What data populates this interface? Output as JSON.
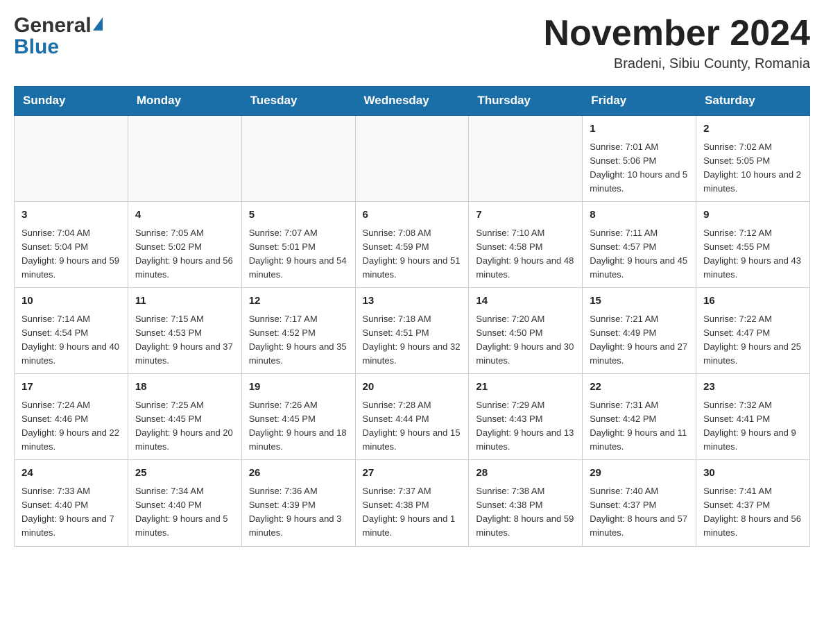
{
  "header": {
    "month_title": "November 2024",
    "location": "Bradeni, Sibiu County, Romania",
    "logo_general": "General",
    "logo_blue": "Blue"
  },
  "weekdays": [
    "Sunday",
    "Monday",
    "Tuesday",
    "Wednesday",
    "Thursday",
    "Friday",
    "Saturday"
  ],
  "weeks": [
    [
      {
        "day": "",
        "info": ""
      },
      {
        "day": "",
        "info": ""
      },
      {
        "day": "",
        "info": ""
      },
      {
        "day": "",
        "info": ""
      },
      {
        "day": "",
        "info": ""
      },
      {
        "day": "1",
        "info": "Sunrise: 7:01 AM\nSunset: 5:06 PM\nDaylight: 10 hours and 5 minutes."
      },
      {
        "day": "2",
        "info": "Sunrise: 7:02 AM\nSunset: 5:05 PM\nDaylight: 10 hours and 2 minutes."
      }
    ],
    [
      {
        "day": "3",
        "info": "Sunrise: 7:04 AM\nSunset: 5:04 PM\nDaylight: 9 hours and 59 minutes."
      },
      {
        "day": "4",
        "info": "Sunrise: 7:05 AM\nSunset: 5:02 PM\nDaylight: 9 hours and 56 minutes."
      },
      {
        "day": "5",
        "info": "Sunrise: 7:07 AM\nSunset: 5:01 PM\nDaylight: 9 hours and 54 minutes."
      },
      {
        "day": "6",
        "info": "Sunrise: 7:08 AM\nSunset: 4:59 PM\nDaylight: 9 hours and 51 minutes."
      },
      {
        "day": "7",
        "info": "Sunrise: 7:10 AM\nSunset: 4:58 PM\nDaylight: 9 hours and 48 minutes."
      },
      {
        "day": "8",
        "info": "Sunrise: 7:11 AM\nSunset: 4:57 PM\nDaylight: 9 hours and 45 minutes."
      },
      {
        "day": "9",
        "info": "Sunrise: 7:12 AM\nSunset: 4:55 PM\nDaylight: 9 hours and 43 minutes."
      }
    ],
    [
      {
        "day": "10",
        "info": "Sunrise: 7:14 AM\nSunset: 4:54 PM\nDaylight: 9 hours and 40 minutes."
      },
      {
        "day": "11",
        "info": "Sunrise: 7:15 AM\nSunset: 4:53 PM\nDaylight: 9 hours and 37 minutes."
      },
      {
        "day": "12",
        "info": "Sunrise: 7:17 AM\nSunset: 4:52 PM\nDaylight: 9 hours and 35 minutes."
      },
      {
        "day": "13",
        "info": "Sunrise: 7:18 AM\nSunset: 4:51 PM\nDaylight: 9 hours and 32 minutes."
      },
      {
        "day": "14",
        "info": "Sunrise: 7:20 AM\nSunset: 4:50 PM\nDaylight: 9 hours and 30 minutes."
      },
      {
        "day": "15",
        "info": "Sunrise: 7:21 AM\nSunset: 4:49 PM\nDaylight: 9 hours and 27 minutes."
      },
      {
        "day": "16",
        "info": "Sunrise: 7:22 AM\nSunset: 4:47 PM\nDaylight: 9 hours and 25 minutes."
      }
    ],
    [
      {
        "day": "17",
        "info": "Sunrise: 7:24 AM\nSunset: 4:46 PM\nDaylight: 9 hours and 22 minutes."
      },
      {
        "day": "18",
        "info": "Sunrise: 7:25 AM\nSunset: 4:45 PM\nDaylight: 9 hours and 20 minutes."
      },
      {
        "day": "19",
        "info": "Sunrise: 7:26 AM\nSunset: 4:45 PM\nDaylight: 9 hours and 18 minutes."
      },
      {
        "day": "20",
        "info": "Sunrise: 7:28 AM\nSunset: 4:44 PM\nDaylight: 9 hours and 15 minutes."
      },
      {
        "day": "21",
        "info": "Sunrise: 7:29 AM\nSunset: 4:43 PM\nDaylight: 9 hours and 13 minutes."
      },
      {
        "day": "22",
        "info": "Sunrise: 7:31 AM\nSunset: 4:42 PM\nDaylight: 9 hours and 11 minutes."
      },
      {
        "day": "23",
        "info": "Sunrise: 7:32 AM\nSunset: 4:41 PM\nDaylight: 9 hours and 9 minutes."
      }
    ],
    [
      {
        "day": "24",
        "info": "Sunrise: 7:33 AM\nSunset: 4:40 PM\nDaylight: 9 hours and 7 minutes."
      },
      {
        "day": "25",
        "info": "Sunrise: 7:34 AM\nSunset: 4:40 PM\nDaylight: 9 hours and 5 minutes."
      },
      {
        "day": "26",
        "info": "Sunrise: 7:36 AM\nSunset: 4:39 PM\nDaylight: 9 hours and 3 minutes."
      },
      {
        "day": "27",
        "info": "Sunrise: 7:37 AM\nSunset: 4:38 PM\nDaylight: 9 hours and 1 minute."
      },
      {
        "day": "28",
        "info": "Sunrise: 7:38 AM\nSunset: 4:38 PM\nDaylight: 8 hours and 59 minutes."
      },
      {
        "day": "29",
        "info": "Sunrise: 7:40 AM\nSunset: 4:37 PM\nDaylight: 8 hours and 57 minutes."
      },
      {
        "day": "30",
        "info": "Sunrise: 7:41 AM\nSunset: 4:37 PM\nDaylight: 8 hours and 56 minutes."
      }
    ]
  ]
}
